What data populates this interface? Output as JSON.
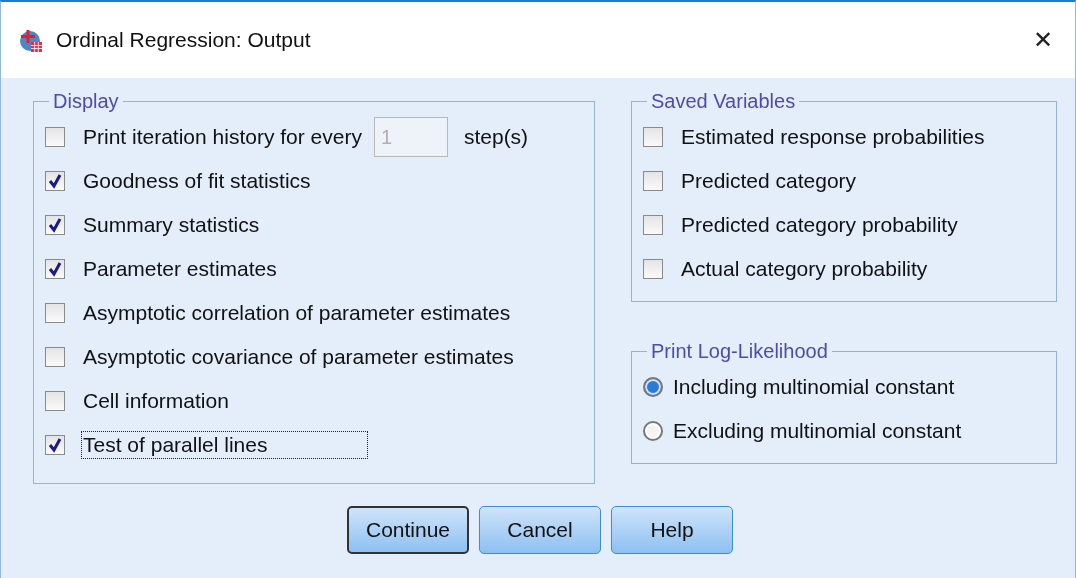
{
  "window": {
    "title": "Ordinal Regression: Output",
    "close": "✕"
  },
  "display": {
    "title": "Display",
    "iteration": {
      "label": "Print iteration history for every",
      "checked": false,
      "value": "1",
      "disabled": true,
      "suffix": "step(s)"
    },
    "options": [
      {
        "label": "Goodness of fit statistics",
        "checked": true,
        "focused": false
      },
      {
        "label": "Summary statistics",
        "checked": true,
        "focused": false
      },
      {
        "label": "Parameter estimates",
        "checked": true,
        "focused": false
      },
      {
        "label": "Asymptotic correlation of parameter estimates",
        "checked": false,
        "focused": false
      },
      {
        "label": "Asymptotic covariance of parameter estimates",
        "checked": false,
        "focused": false
      },
      {
        "label": "Cell information",
        "checked": false,
        "focused": false
      },
      {
        "label": "Test of parallel lines",
        "checked": true,
        "focused": true
      }
    ]
  },
  "saved_variables": {
    "title": "Saved Variables",
    "options": [
      {
        "label": "Estimated response probabilities",
        "checked": false
      },
      {
        "label": "Predicted category",
        "checked": false
      },
      {
        "label": "Predicted category probability",
        "checked": false
      },
      {
        "label": "Actual category probability",
        "checked": false
      }
    ]
  },
  "log_likelihood": {
    "title": "Print Log-Likelihood",
    "options": [
      {
        "label": "Including multinomial constant",
        "selected": true
      },
      {
        "label": "Excluding multinomial constant",
        "selected": false
      }
    ]
  },
  "buttons": [
    {
      "label": "Continue",
      "default": true
    },
    {
      "label": "Cancel",
      "default": false
    },
    {
      "label": "Help",
      "default": false
    }
  ]
}
